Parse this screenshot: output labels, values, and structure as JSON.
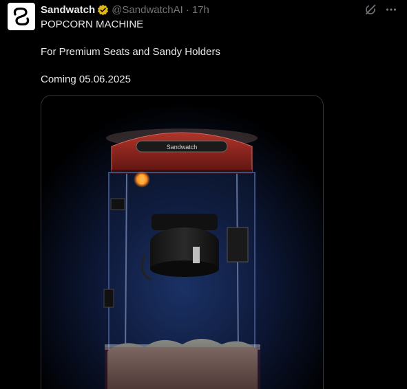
{
  "tweet": {
    "author_name": "Sandwatch",
    "handle": "@SandwatchAI",
    "separator": "·",
    "time": "17h",
    "lines": [
      "POPCORN MACHINE",
      "For Premium Seats and Sandy Holders",
      "Coming 05.06.2025"
    ]
  },
  "media": {
    "sign_text": "Sandwatch",
    "description_icon": "popcorn-machine-image"
  },
  "icons": {
    "avatar": "sandwatch-logo-icon",
    "verified": "verified-badge-icon",
    "grok": "grok-icon",
    "more": "more-options-icon"
  },
  "colors": {
    "background": "#000000",
    "text": "#e7e9ea",
    "muted": "#71767b",
    "verified": "#e2b719",
    "machine_red": "#8a1f1a"
  }
}
